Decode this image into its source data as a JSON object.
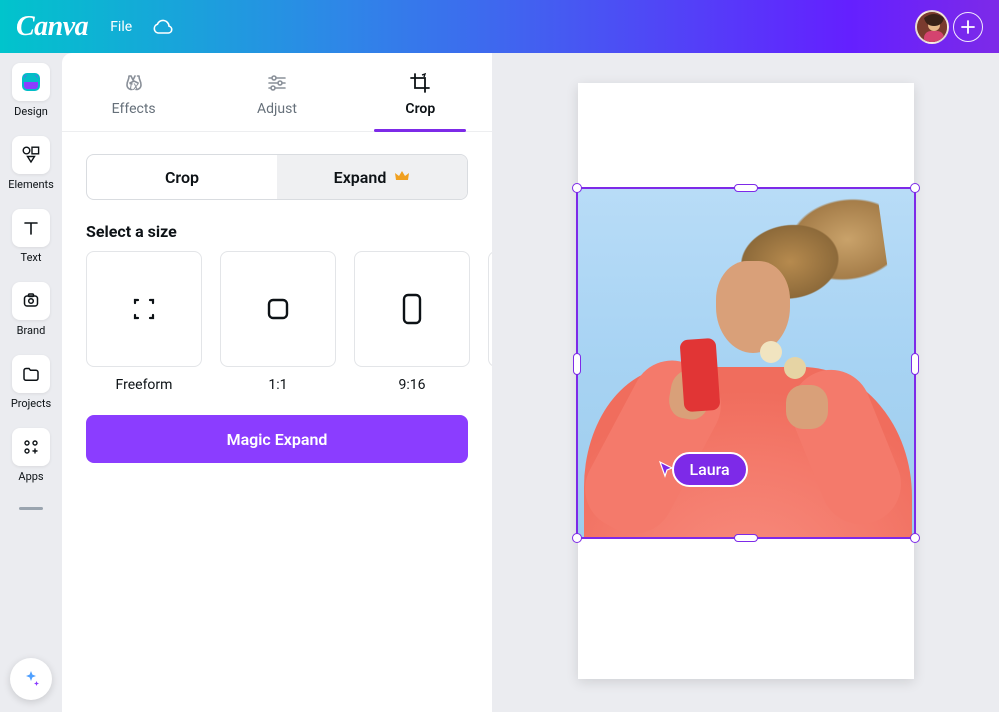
{
  "header": {
    "logo_text": "Canva",
    "file_label": "File"
  },
  "sidebar": {
    "items": [
      {
        "label": "Design"
      },
      {
        "label": "Elements"
      },
      {
        "label": "Text"
      },
      {
        "label": "Brand"
      },
      {
        "label": "Projects"
      },
      {
        "label": "Apps"
      }
    ]
  },
  "panel": {
    "tabs": [
      {
        "label": "Effects"
      },
      {
        "label": "Adjust"
      },
      {
        "label": "Crop"
      }
    ],
    "segmented": {
      "crop": "Crop",
      "expand": "Expand"
    },
    "section_title": "Select a size",
    "sizes": [
      {
        "label": "Freeform"
      },
      {
        "label": "1:1"
      },
      {
        "label": "9:16"
      }
    ],
    "action_button": "Magic Expand"
  },
  "collaborator": {
    "name": "Laura"
  },
  "colors": {
    "accent": "#8b3dff",
    "selection": "#7d2ae8"
  }
}
